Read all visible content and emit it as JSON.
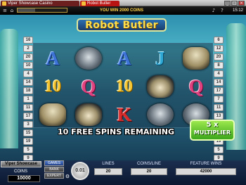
{
  "browser": {
    "tabs": [
      {
        "label": "Viper Showcase Casino"
      },
      {
        "label": "Robot Butler"
      }
    ]
  },
  "topbar": {
    "message": "YOU WIN 2000 COINS",
    "clock": "15:12",
    "progress_fraction": 0.35
  },
  "game": {
    "logo": "Robot Butler",
    "left_lines": [
      "16",
      "2",
      "20",
      "10",
      "4",
      "14",
      "18",
      "1",
      "11",
      "17",
      "3",
      "15",
      "19",
      "5",
      "9"
    ],
    "right_lines": [
      "6",
      "12",
      "20",
      "8",
      "4",
      "14",
      "17",
      "7",
      "11",
      "13",
      "3",
      "15",
      "19",
      "5",
      "9"
    ],
    "reels": [
      [
        "A",
        "10",
        "bot"
      ],
      [
        "robot",
        "Q",
        "car"
      ],
      [
        "A",
        "10",
        "K"
      ],
      [
        "J",
        "car",
        "robot"
      ],
      [
        "bot",
        "Q",
        "robot"
      ]
    ],
    "spins_remaining": "10 FREE SPINS REMAINING",
    "multiplier_value": "5 x",
    "multiplier_label": "MULTIPLIER"
  },
  "panel": {
    "brand": "Viper Showcase",
    "coins_label": "COINS",
    "coins_value": "10000",
    "game_buttons": [
      "GAMES",
      "BANK",
      "EXPERT"
    ],
    "active_button": "GAMES",
    "chip_value": "0.01",
    "stats": [
      {
        "label": "LINES",
        "value": "20"
      },
      {
        "label": "COINS/LINE",
        "value": "20"
      },
      {
        "label": "FEATURE WINS",
        "value": "42000"
      }
    ]
  },
  "colors": {
    "tab_active": "#b81414",
    "message": "#ffd54a",
    "multiplier": "#6fd13a"
  }
}
